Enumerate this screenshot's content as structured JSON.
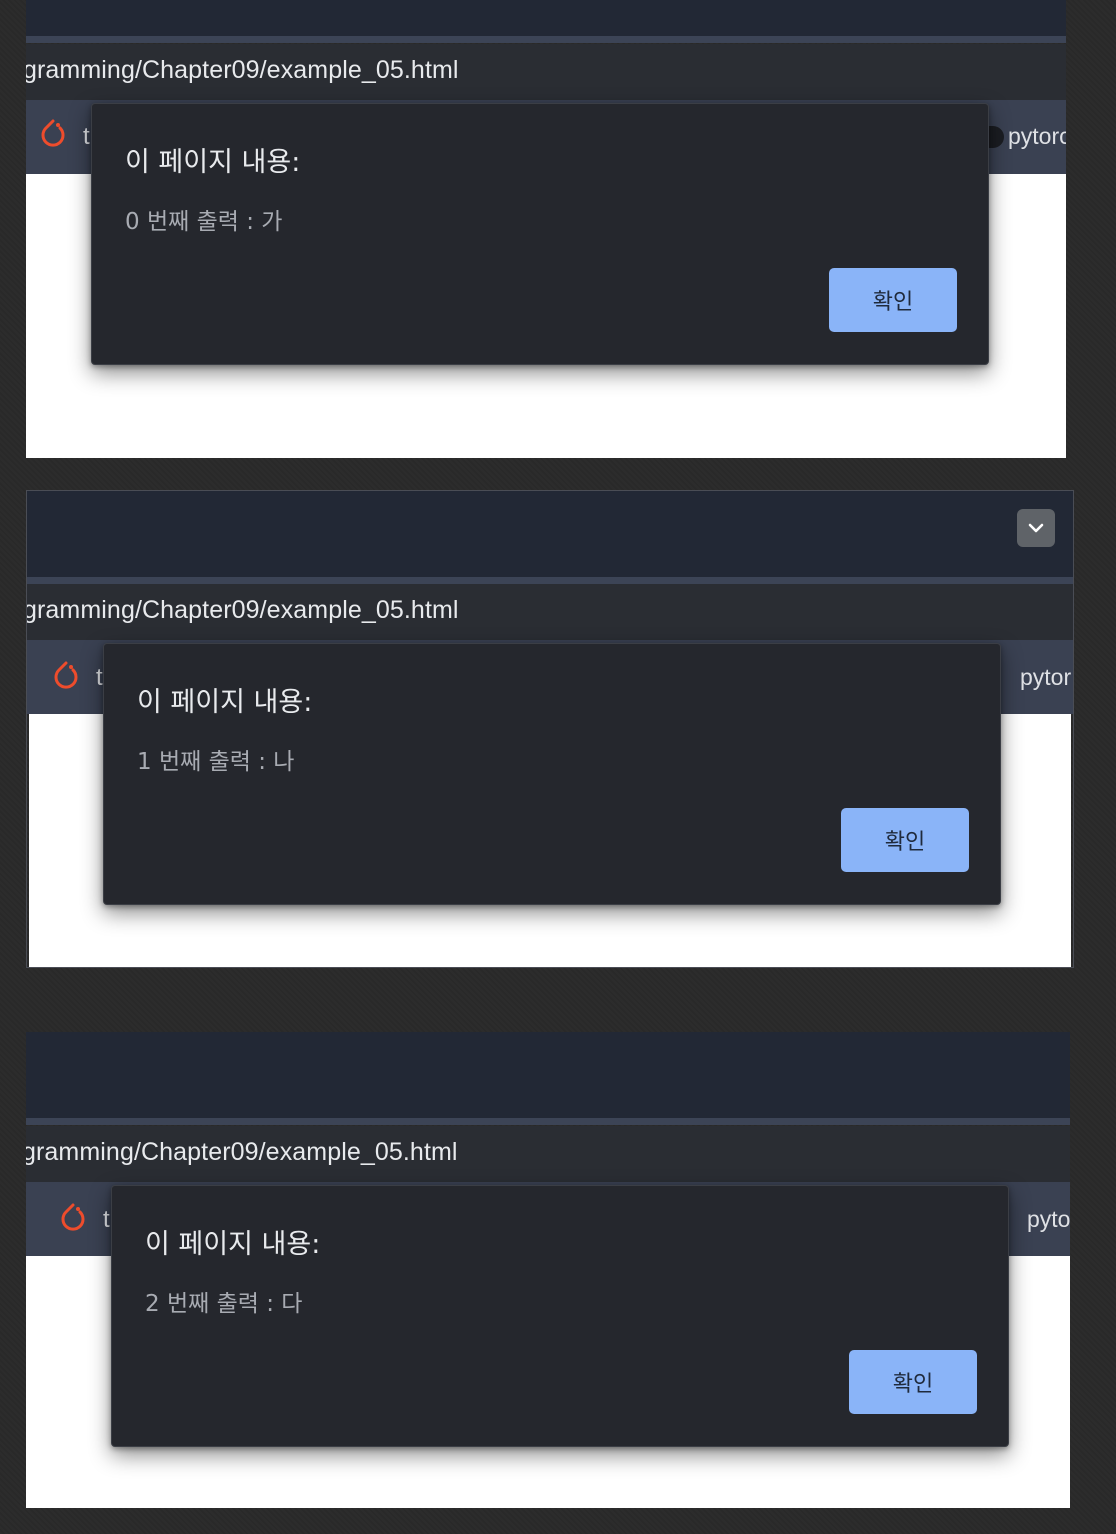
{
  "screenshots": [
    {
      "url": "gramming/Chapter09/example_05.html",
      "bookmark_left_letter": "t",
      "bookmark_right_label": "pytorc",
      "dialog": {
        "title": "이 페이지 내용:",
        "message": "0 번째 출력 : 가",
        "ok_label": "확인"
      }
    },
    {
      "url": "gramming/Chapter09/example_05.html",
      "bookmark_left_letter": "t",
      "bookmark_right_label": "pytor",
      "dialog": {
        "title": "이 페이지 내용:",
        "message": "1 번째 출력 : 나",
        "ok_label": "확인"
      }
    },
    {
      "url": "gramming/Chapter09/example_05.html",
      "bookmark_left_letter": "t",
      "bookmark_right_label": "pyto",
      "dialog": {
        "title": "이 페이지 내용:",
        "message": "2 번째 출력 : 다",
        "ok_label": "확인"
      }
    }
  ],
  "icons": {
    "bookmark_icon": "pytorch-flame-icon",
    "tab_menu_icon": "chevron-down-icon"
  },
  "colors": {
    "dialog_button": "#8ab4f8",
    "pytorch_icon": "#ee4c2c"
  }
}
